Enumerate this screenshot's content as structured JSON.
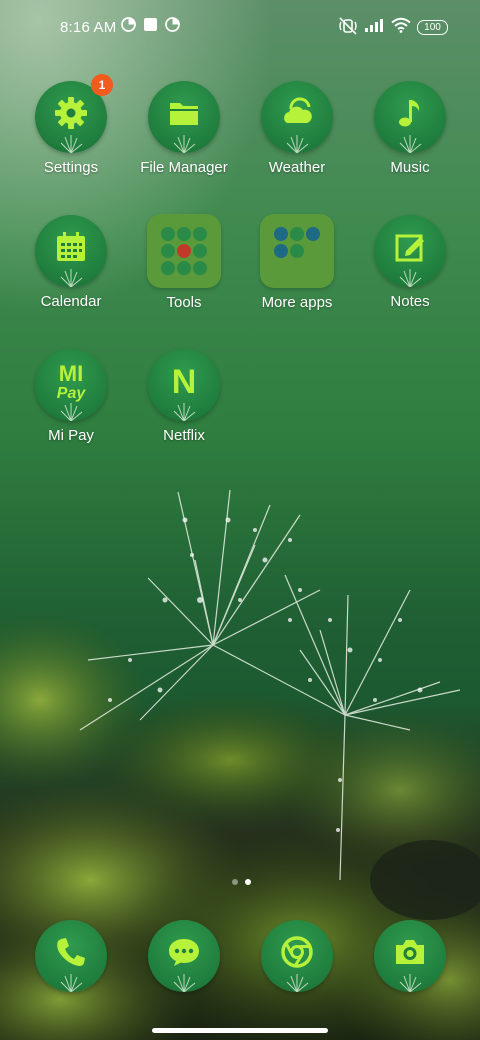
{
  "status_bar": {
    "time": "8:16 AM",
    "battery": "100",
    "icons": [
      "data-saver-icon",
      "square-notification-icon",
      "data-saver-icon",
      "silent-icon",
      "signal-icon",
      "wifi-icon",
      "battery-icon"
    ]
  },
  "badge": {
    "settings": "1"
  },
  "apps": [
    {
      "label": "Settings",
      "icon": "gear-icon"
    },
    {
      "label": "File Manager",
      "icon": "folder-icon"
    },
    {
      "label": "Weather",
      "icon": "cloud-sun-icon"
    },
    {
      "label": "Music",
      "icon": "music-note-icon"
    },
    {
      "label": "Calendar",
      "icon": "calendar-icon"
    },
    {
      "label": "Tools",
      "icon": "folder-grid-icon"
    },
    {
      "label": "More apps",
      "icon": "folder-grid-icon"
    },
    {
      "label": "Notes",
      "icon": "note-pencil-icon"
    },
    {
      "label": "Mi Pay",
      "icon": "mi-pay-icon",
      "glyph_text": "MI",
      "glyph_sub": "Pay"
    },
    {
      "label": "Netflix",
      "icon": "netflix-icon",
      "glyph_text": "N"
    }
  ],
  "dock": [
    {
      "icon": "phone-icon"
    },
    {
      "icon": "message-icon"
    },
    {
      "icon": "chrome-icon"
    },
    {
      "icon": "camera-icon"
    }
  ],
  "page_indicator": {
    "pages": 2,
    "current": 2
  },
  "colors": {
    "accent": "#b6f23a",
    "icon_bg": "#1f7d3d",
    "badge": "#f25a1e"
  }
}
